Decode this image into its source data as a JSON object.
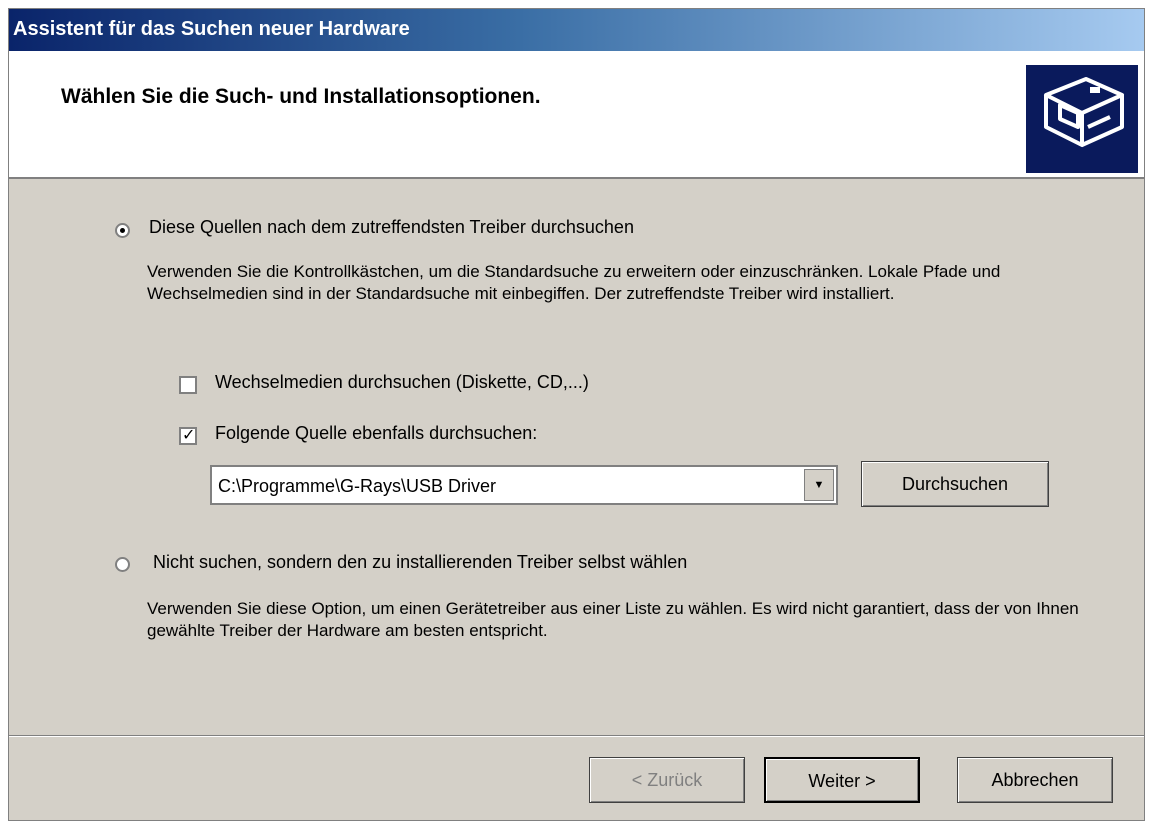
{
  "window": {
    "title": "Assistent für das Suchen neuer Hardware"
  },
  "header": {
    "title": "Wählen Sie die Such- und Installationsoptionen.",
    "icon": "hardware-wizard-icon"
  },
  "option_search": {
    "label": "Diese Quellen nach dem zutreffendsten Treiber durchsuchen",
    "selected": true,
    "description": "Verwenden Sie die Kontrollkästchen, um die Standardsuche zu erweitern oder einzuschränken. Lokale Pfade und Wechselmedien sind in der Standardsuche mit einbegiffen. Der zutreffendste Treiber wird installiert.",
    "removable_media": {
      "label": "Wechselmedien durchsuchen (Diskette, CD,...)",
      "checked": false
    },
    "include_location": {
      "label": "Folgende Quelle ebenfalls durchsuchen:",
      "checked": true
    },
    "path": {
      "value": "C:\\Programme\\G-Rays\\USB Driver"
    },
    "browse_label": "Durchsuchen"
  },
  "option_manual": {
    "label": "Nicht suchen, sondern den zu installierenden Treiber selbst wählen",
    "selected": false,
    "description": "Verwenden Sie diese Option, um einen Gerätetreiber aus einer Liste zu wählen. Es wird nicht garantiert, dass der von Ihnen gewählte Treiber der Hardware am besten entspricht."
  },
  "footer": {
    "back_label": "< Zurück",
    "next_label": "Weiter >",
    "cancel_label": "Abbrechen"
  },
  "colors": {
    "dialog_bg": "#d4d0c8",
    "title_start": "#0a246a",
    "title_end": "#a6caf0",
    "icon_bg": "#0a1a5c"
  }
}
